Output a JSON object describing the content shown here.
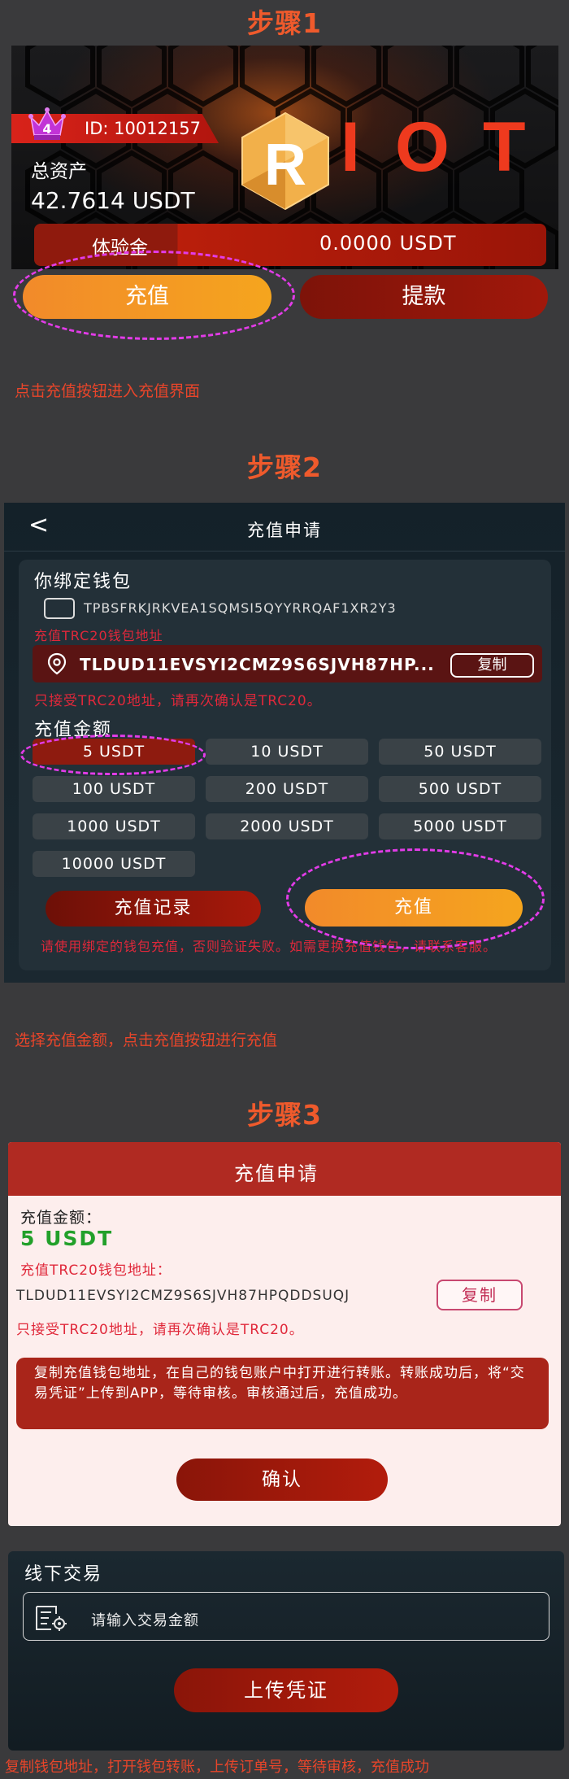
{
  "steps": {
    "step1": "步骤1",
    "step2": "步骤2",
    "step3": "步骤3"
  },
  "step1": {
    "vip_level": "4",
    "user_id": "ID: 10012157",
    "logo_letters": [
      "R",
      "I",
      "O",
      "T"
    ],
    "total_assets_label": "总资产",
    "total_assets_value": "42.7614 USDT",
    "trial_label": "体验金",
    "trial_value": "0.0000 USDT",
    "topup_button": "充值",
    "withdraw_button": "提款",
    "caption": "点击充值按钮进入充值界面"
  },
  "step2": {
    "back_icon": "chevron-left-icon",
    "nav_title": "充值申请",
    "wallet_title": "你绑定钱包",
    "wallet_address": "TPBSFRKJRKVEA1SQMSI5QYYRRQAF1XR2Y3",
    "trc_label": "充值TRC20钱包地址",
    "trc_address": "TLDUD11EVSYI2CMZ9S6SJVH87HP...",
    "copy_button": "复制",
    "warning": "只接受TRC20地址，请再次确认是TRC20。",
    "amount_title": "充值金额",
    "amounts": [
      "5 USDT",
      "10 USDT",
      "50 USDT",
      "100 USDT",
      "200 USDT",
      "500 USDT",
      "1000 USDT",
      "2000 USDT",
      "5000 USDT",
      "10000 USDT"
    ],
    "selected_amount": "5 USDT",
    "records_button": "充值记录",
    "topup_button": "充值",
    "notice": "请使用绑定的钱包充值，否则验证失败。如需更换充值钱包，请联系客服。",
    "caption": "选择充值金额，点击充值按钮进行充值"
  },
  "step3": {
    "dialog_title": "充值申请",
    "amount_label": "充值金额：",
    "amount_value": "5 USDT",
    "trc_label": "充值TRC20钱包地址：",
    "trc_address": "TLDUD11EVSYI2CMZ9S6SJVH87HPQDDSUQJ",
    "copy_button": "复制",
    "warning": "只接受TRC20地址，请再次确认是TRC20。",
    "info": "复制充值钱包地址，在自己的钱包账户中打开进行转账。转账成功后，将“交易凭证”上传到APP，等待审核。审核通过后，充值成功。",
    "confirm_button": "确认",
    "offline_title": "线下交易",
    "offline_placeholder": "请输入交易金额",
    "upload_button": "上传凭证",
    "caption": "复制钱包地址，打开钱包转账，上传订单号，等待审核，充值成功"
  },
  "colors": {
    "accent_orange": "#f5a51e",
    "accent_red": "#b21c0c",
    "caption_red": "#e8452a",
    "highlight_magenta": "#e23ce8",
    "amount_green": "#22a02a"
  }
}
